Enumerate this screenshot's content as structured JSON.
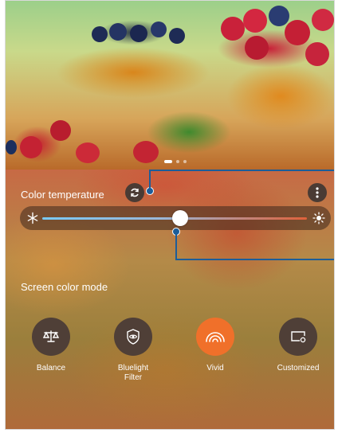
{
  "colors": {
    "callout": "#1c5d99",
    "active_mode": "#f0702a",
    "inactive_mode": "#4f3f37",
    "slider_cool": "#79c9f5",
    "slider_warm": "#e0613a"
  },
  "page_indicator": {
    "pages": 3,
    "active": 0
  },
  "color_temperature": {
    "label": "Color temperature",
    "reset_icon": "refresh-icon",
    "menu_icon": "more-vertical-icon",
    "slider": {
      "cool_icon": "snowflake-icon",
      "warm_icon": "sun-icon",
      "value_fraction": 0.52
    }
  },
  "screen_color_mode": {
    "label": "Screen color mode",
    "modes": [
      {
        "label": "Balance",
        "icon": "balance-scale-icon",
        "selected": false
      },
      {
        "label": "Bluelight\nFilter",
        "icon": "eye-shield-icon",
        "selected": false
      },
      {
        "label": "Vivid",
        "icon": "rainbow-icon",
        "selected": true
      },
      {
        "label": "Customized",
        "icon": "custom-display-icon",
        "selected": false
      }
    ]
  }
}
